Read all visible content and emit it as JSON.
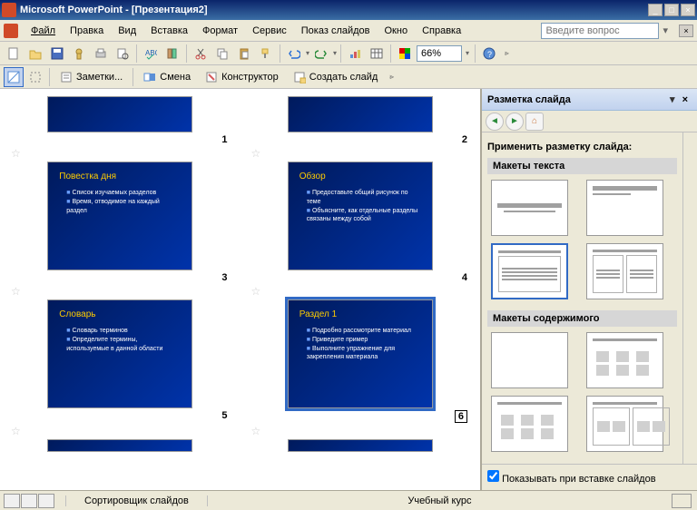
{
  "title": "Microsoft PowerPoint - [Презентация2]",
  "menus": [
    "Файл",
    "Правка",
    "Вид",
    "Вставка",
    "Формат",
    "Сервис",
    "Показ слайдов",
    "Окно",
    "Справка"
  ],
  "help_placeholder": "Введите вопрос",
  "zoom": "66%",
  "outline_buttons": {
    "notes": "Заметки...",
    "change": "Смена",
    "designer": "Конструктор",
    "new_slide": "Создать слайд"
  },
  "taskpane": {
    "title": "Разметка слайда",
    "apply_label": "Применить разметку слайда:",
    "section_text": "Макеты текста",
    "section_content": "Макеты содержимого",
    "show_on_insert": "Показывать при вставке слайдов"
  },
  "slides": [
    {
      "num": "1",
      "title": "",
      "body": []
    },
    {
      "num": "2",
      "title": "",
      "body": []
    },
    {
      "num": "3",
      "title": "Повестка дня",
      "body": [
        "Список изучаемых разделов",
        "Время, отводимое на каждый раздел"
      ]
    },
    {
      "num": "4",
      "title": "Обзор",
      "body": [
        "Предоставьте общий рисунок по теме",
        "Объясните, как отдельные разделы связаны между собой"
      ]
    },
    {
      "num": "5",
      "title": "Словарь",
      "body": [
        "Словарь терминов",
        "Определите термины, используемые в данной области"
      ]
    },
    {
      "num": "6",
      "title": "Раздел 1",
      "body": [
        "Подробно рассмотрите материал",
        "Приведите пример",
        "Выполните упражнение для закрепления материала"
      ]
    }
  ],
  "status": {
    "left": "Сортировщик слайдов",
    "center": "Учебный курс"
  },
  "chart_data": null
}
